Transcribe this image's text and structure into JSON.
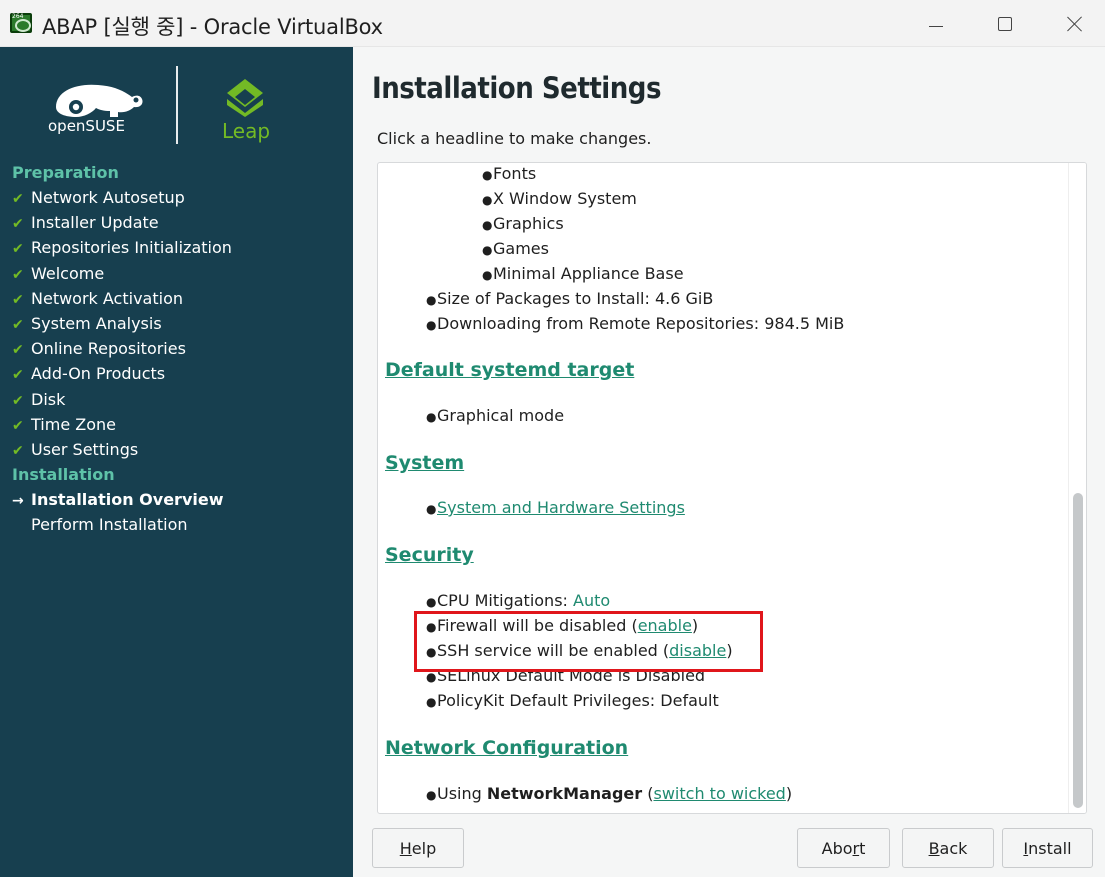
{
  "window": {
    "title": "ABAP [실행 중] - Oracle VirtualBox",
    "icon": "virtualbox-icon"
  },
  "sidebar": {
    "logo_left_text": "openSUSE",
    "logo_right_text": "Leap",
    "sections": [
      {
        "label": "Preparation",
        "items": [
          {
            "label": "Network Autosetup",
            "status": "done"
          },
          {
            "label": "Installer Update",
            "status": "done"
          },
          {
            "label": "Repositories Initialization",
            "status": "done"
          },
          {
            "label": "Welcome",
            "status": "done"
          },
          {
            "label": "Network Activation",
            "status": "done"
          },
          {
            "label": "System Analysis",
            "status": "done"
          },
          {
            "label": "Online Repositories",
            "status": "done"
          },
          {
            "label": "Add-On Products",
            "status": "done"
          },
          {
            "label": "Disk",
            "status": "done"
          },
          {
            "label": "Time Zone",
            "status": "done"
          },
          {
            "label": "User Settings",
            "status": "done"
          }
        ]
      },
      {
        "label": "Installation",
        "items": [
          {
            "label": "Installation Overview",
            "status": "current"
          },
          {
            "label": "Perform Installation",
            "status": "pending"
          }
        ]
      }
    ]
  },
  "main": {
    "title": "Installation Settings",
    "subtitle": "Click a headline to make changes.",
    "software_items": [
      "Fonts",
      "X Window System",
      "Graphics",
      "Games",
      "Minimal Appliance Base"
    ],
    "software_summary": [
      "Size of Packages to Install: 4.6 GiB",
      "Downloading from Remote Repositories: 984.5 MiB"
    ],
    "systemd": {
      "heading": "Default systemd target",
      "item": "Graphical mode"
    },
    "system": {
      "heading": "System",
      "link": "System and Hardware Settings"
    },
    "security": {
      "heading": "Security",
      "cpu_label": "CPU Mitigations: ",
      "cpu_value": "Auto",
      "firewall_text": "Firewall will be disabled (",
      "firewall_link": "enable",
      "ssh_text": "SSH service will be enabled (",
      "ssh_link": "disable",
      "close_paren": ")",
      "selinux": "SELinux Default Mode is Disabled",
      "policykit": "PolicyKit Default Privileges: Default"
    },
    "network": {
      "heading": "Network Configuration",
      "using_text": "Using ",
      "manager": "NetworkManager",
      "open_paren": " (",
      "link": "switch to wicked",
      "close_paren": ")"
    }
  },
  "buttons": {
    "help": {
      "label": "Help",
      "mnemonic": "H",
      "rest": "elp"
    },
    "abort": {
      "label": "Abort",
      "pre": "Abo",
      "mnemonic": "r",
      "rest": "t"
    },
    "back": {
      "label": "Back",
      "mnemonic": "B",
      "rest": "ack"
    },
    "install": {
      "label": "Install",
      "mnemonic": "I",
      "rest": "nstall"
    }
  },
  "colors": {
    "sidebar_bg": "#173f4f",
    "accent_green": "#73ba25",
    "link_teal": "#1f8a70",
    "highlight_red": "#e0161b"
  }
}
